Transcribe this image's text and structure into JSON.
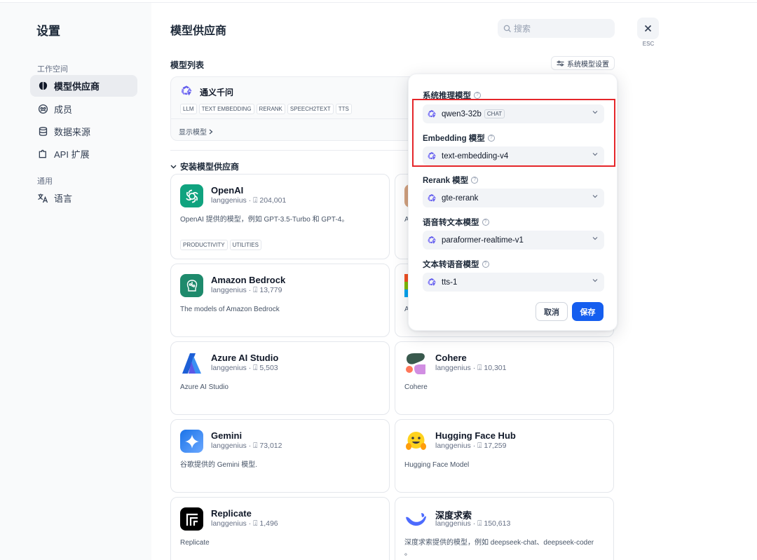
{
  "sidebar": {
    "title": "设置",
    "workspace_label": "工作空间",
    "general_label": "通用",
    "items": [
      {
        "label": "模型供应商"
      },
      {
        "label": "成员"
      },
      {
        "label": "数据来源"
      },
      {
        "label": "API 扩展"
      },
      {
        "label": "语言"
      }
    ]
  },
  "header": {
    "title": "模型供应商",
    "search_placeholder": "搜索",
    "esc_label": "ESC"
  },
  "model_list": {
    "title": "模型列表",
    "system_settings_button": "系统模型设置",
    "provider": {
      "name": "通义千问",
      "tags": [
        "LLM",
        "TEXT EMBEDDING",
        "RERANK",
        "SPEECH2TEXT",
        "TTS"
      ],
      "show_models": "显示模型"
    }
  },
  "install": {
    "title": "安装模型供应商",
    "cards": [
      {
        "name": "OpenAI",
        "author": "langgenius",
        "downloads": "204,001",
        "desc": "OpenAI 提供的模型，例如 GPT-3.5-Turbo 和 GPT-4。",
        "tags": [
          "PRODUCTIVITY",
          "UTILITIES"
        ]
      },
      {
        "name": "Amazon Bedrock",
        "author": "langgenius",
        "downloads": "13,779",
        "desc": "The models of Amazon Bedrock"
      },
      {
        "name": "Azure AI Studio",
        "author": "langgenius",
        "downloads": "5,503",
        "desc": "Azure AI Studio"
      },
      {
        "name": "Cohere",
        "author": "langgenius",
        "downloads": "10,301",
        "desc": "Cohere"
      },
      {
        "name": "Gemini",
        "author": "langgenius",
        "downloads": "73,012",
        "desc": "谷歌提供的 Gemini 模型."
      },
      {
        "name": "Hugging Face Hub",
        "author": "langgenius",
        "downloads": "17,259",
        "desc": "Hugging Face Model"
      },
      {
        "name": "Replicate",
        "author": "langgenius",
        "downloads": "1,496",
        "desc": "Replicate"
      },
      {
        "name": "深度求索",
        "author": "langgenius",
        "downloads": "150,613",
        "desc": "深度求索提供的模型，例如 deepseek-chat、deepseek-coder",
        "desc_tail": "。"
      }
    ],
    "partial_descs": [
      "A",
      "A"
    ]
  },
  "popover": {
    "fields": [
      {
        "label": "系统推理模型",
        "value": "qwen3-32b",
        "badge": "CHAT"
      },
      {
        "label": "Embedding 模型",
        "value": "text-embedding-v4"
      },
      {
        "label": "Rerank 模型",
        "value": "gte-rerank"
      },
      {
        "label": "语音转文本模型",
        "value": "paraformer-realtime-v1"
      },
      {
        "label": "文本转语音模型",
        "value": "tts-1"
      }
    ],
    "cancel": "取消",
    "save": "保存"
  },
  "colors": {
    "accent": "#155eef",
    "highlight": "#e5262a",
    "qwen": "#615ced"
  },
  "icons": {
    "qwen": "qwen-logo-icon",
    "search": "search-icon",
    "close": "close-icon",
    "chevron": "chevron-down-icon",
    "download": "download-icon"
  }
}
